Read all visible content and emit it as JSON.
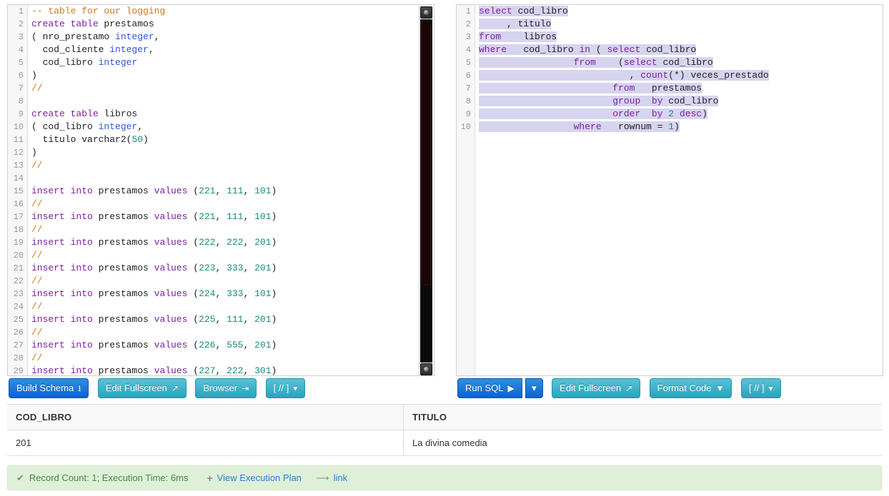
{
  "schema_editor": {
    "line_numbers": [
      1,
      2,
      3,
      4,
      5,
      6,
      7,
      8,
      9,
      10,
      11,
      12,
      13,
      14,
      15,
      16,
      17,
      18,
      19,
      20,
      21,
      22,
      23,
      24,
      25,
      26,
      27,
      28,
      29
    ],
    "lines": [
      [
        {
          "t": "cmt",
          "v": "-- table for our logging"
        }
      ],
      [
        {
          "t": "kw",
          "v": "create table "
        },
        {
          "t": "pln",
          "v": "prestamos"
        }
      ],
      [
        {
          "t": "pln",
          "v": "( nro_prestamo "
        },
        {
          "t": "typ",
          "v": "integer"
        },
        {
          "t": "pln",
          "v": ","
        }
      ],
      [
        {
          "t": "pln",
          "v": "  cod_cliente "
        },
        {
          "t": "typ",
          "v": "integer"
        },
        {
          "t": "pln",
          "v": ","
        }
      ],
      [
        {
          "t": "pln",
          "v": "  cod_libro "
        },
        {
          "t": "typ",
          "v": "integer"
        }
      ],
      [
        {
          "t": "pln",
          "v": ")"
        }
      ],
      [
        {
          "t": "cmt",
          "v": "//"
        }
      ],
      [],
      [
        {
          "t": "kw",
          "v": "create table "
        },
        {
          "t": "pln",
          "v": "libros"
        }
      ],
      [
        {
          "t": "pln",
          "v": "( cod_libro "
        },
        {
          "t": "typ",
          "v": "integer"
        },
        {
          "t": "pln",
          "v": ","
        }
      ],
      [
        {
          "t": "pln",
          "v": "  titulo varchar2("
        },
        {
          "t": "num",
          "v": "50"
        },
        {
          "t": "pln",
          "v": ")"
        }
      ],
      [
        {
          "t": "pln",
          "v": ")"
        }
      ],
      [
        {
          "t": "cmt",
          "v": "//"
        }
      ],
      [],
      [
        {
          "t": "kw",
          "v": "insert into "
        },
        {
          "t": "pln",
          "v": "prestamos "
        },
        {
          "t": "kw",
          "v": "values "
        },
        {
          "t": "pln",
          "v": "("
        },
        {
          "t": "num",
          "v": "221"
        },
        {
          "t": "pln",
          "v": ", "
        },
        {
          "t": "num",
          "v": "111"
        },
        {
          "t": "pln",
          "v": ", "
        },
        {
          "t": "num",
          "v": "101"
        },
        {
          "t": "pln",
          "v": ")"
        }
      ],
      [
        {
          "t": "cmt",
          "v": "//"
        }
      ],
      [
        {
          "t": "kw",
          "v": "insert into "
        },
        {
          "t": "pln",
          "v": "prestamos "
        },
        {
          "t": "kw",
          "v": "values "
        },
        {
          "t": "pln",
          "v": "("
        },
        {
          "t": "num",
          "v": "221"
        },
        {
          "t": "pln",
          "v": ", "
        },
        {
          "t": "num",
          "v": "111"
        },
        {
          "t": "pln",
          "v": ", "
        },
        {
          "t": "num",
          "v": "101"
        },
        {
          "t": "pln",
          "v": ")"
        }
      ],
      [
        {
          "t": "cmt",
          "v": "//"
        }
      ],
      [
        {
          "t": "kw",
          "v": "insert into "
        },
        {
          "t": "pln",
          "v": "prestamos "
        },
        {
          "t": "kw",
          "v": "values "
        },
        {
          "t": "pln",
          "v": "("
        },
        {
          "t": "num",
          "v": "222"
        },
        {
          "t": "pln",
          "v": ", "
        },
        {
          "t": "num",
          "v": "222"
        },
        {
          "t": "pln",
          "v": ", "
        },
        {
          "t": "num",
          "v": "201"
        },
        {
          "t": "pln",
          "v": ")"
        }
      ],
      [
        {
          "t": "cmt",
          "v": "//"
        }
      ],
      [
        {
          "t": "kw",
          "v": "insert into "
        },
        {
          "t": "pln",
          "v": "prestamos "
        },
        {
          "t": "kw",
          "v": "values "
        },
        {
          "t": "pln",
          "v": "("
        },
        {
          "t": "num",
          "v": "223"
        },
        {
          "t": "pln",
          "v": ", "
        },
        {
          "t": "num",
          "v": "333"
        },
        {
          "t": "pln",
          "v": ", "
        },
        {
          "t": "num",
          "v": "201"
        },
        {
          "t": "pln",
          "v": ")"
        }
      ],
      [
        {
          "t": "cmt",
          "v": "//"
        }
      ],
      [
        {
          "t": "kw",
          "v": "insert into "
        },
        {
          "t": "pln",
          "v": "prestamos "
        },
        {
          "t": "kw",
          "v": "values "
        },
        {
          "t": "pln",
          "v": "("
        },
        {
          "t": "num",
          "v": "224"
        },
        {
          "t": "pln",
          "v": ", "
        },
        {
          "t": "num",
          "v": "333"
        },
        {
          "t": "pln",
          "v": ", "
        },
        {
          "t": "num",
          "v": "101"
        },
        {
          "t": "pln",
          "v": ")"
        }
      ],
      [
        {
          "t": "cmt",
          "v": "//"
        }
      ],
      [
        {
          "t": "kw",
          "v": "insert into "
        },
        {
          "t": "pln",
          "v": "prestamos "
        },
        {
          "t": "kw",
          "v": "values "
        },
        {
          "t": "pln",
          "v": "("
        },
        {
          "t": "num",
          "v": "225"
        },
        {
          "t": "pln",
          "v": ", "
        },
        {
          "t": "num",
          "v": "111"
        },
        {
          "t": "pln",
          "v": ", "
        },
        {
          "t": "num",
          "v": "201"
        },
        {
          "t": "pln",
          "v": ")"
        }
      ],
      [
        {
          "t": "cmt",
          "v": "//"
        }
      ],
      [
        {
          "t": "kw",
          "v": "insert into "
        },
        {
          "t": "pln",
          "v": "prestamos "
        },
        {
          "t": "kw",
          "v": "values "
        },
        {
          "t": "pln",
          "v": "("
        },
        {
          "t": "num",
          "v": "226"
        },
        {
          "t": "pln",
          "v": ", "
        },
        {
          "t": "num",
          "v": "555"
        },
        {
          "t": "pln",
          "v": ", "
        },
        {
          "t": "num",
          "v": "201"
        },
        {
          "t": "pln",
          "v": ")"
        }
      ],
      [
        {
          "t": "cmt",
          "v": "//"
        }
      ],
      [
        {
          "t": "kw",
          "v": "insert into "
        },
        {
          "t": "pln",
          "v": "prestamos "
        },
        {
          "t": "kw",
          "v": "values "
        },
        {
          "t": "pln",
          "v": "("
        },
        {
          "t": "num",
          "v": "227"
        },
        {
          "t": "pln",
          "v": ", "
        },
        {
          "t": "num",
          "v": "222"
        },
        {
          "t": "pln",
          "v": ", "
        },
        {
          "t": "num",
          "v": "301"
        },
        {
          "t": "pln",
          "v": ")"
        }
      ]
    ]
  },
  "query_editor": {
    "line_numbers": [
      1,
      2,
      3,
      4,
      5,
      6,
      7,
      8,
      9,
      10
    ],
    "lines": [
      {
        "selected": true,
        "tokens": [
          {
            "t": "kw",
            "v": "select"
          },
          {
            "t": "pln",
            "v": " cod_libro"
          }
        ]
      },
      {
        "selected": true,
        "tokens": [
          {
            "t": "pln",
            "v": "     , titulo"
          }
        ]
      },
      {
        "selected": true,
        "tokens": [
          {
            "t": "kw",
            "v": "from"
          },
          {
            "t": "pln",
            "v": "    libros"
          }
        ]
      },
      {
        "selected": true,
        "tokens": [
          {
            "t": "kw",
            "v": "where"
          },
          {
            "t": "pln",
            "v": "   cod_libro "
          },
          {
            "t": "kw",
            "v": "in"
          },
          {
            "t": "pln",
            "v": " ( "
          },
          {
            "t": "kw",
            "v": "select"
          },
          {
            "t": "pln",
            "v": " cod_libro"
          }
        ]
      },
      {
        "selected": true,
        "tokens": [
          {
            "t": "pln",
            "v": "                 "
          },
          {
            "t": "kw",
            "v": "from"
          },
          {
            "t": "pln",
            "v": "    ("
          },
          {
            "t": "kw",
            "v": "select"
          },
          {
            "t": "pln",
            "v": " cod_libro"
          }
        ]
      },
      {
        "selected": true,
        "tokens": [
          {
            "t": "pln",
            "v": "                           , "
          },
          {
            "t": "kw",
            "v": "count"
          },
          {
            "t": "pln",
            "v": "(*) veces_prestado"
          }
        ]
      },
      {
        "selected": true,
        "tokens": [
          {
            "t": "pln",
            "v": "                        "
          },
          {
            "t": "kw",
            "v": "from"
          },
          {
            "t": "pln",
            "v": "   prestamos"
          }
        ]
      },
      {
        "selected": true,
        "tokens": [
          {
            "t": "pln",
            "v": "                        "
          },
          {
            "t": "kw",
            "v": "group"
          },
          {
            "t": "pln",
            "v": "  "
          },
          {
            "t": "kw",
            "v": "by"
          },
          {
            "t": "pln",
            "v": " cod_libro"
          }
        ]
      },
      {
        "selected": true,
        "tokens": [
          {
            "t": "pln",
            "v": "                        "
          },
          {
            "t": "kw",
            "v": "order"
          },
          {
            "t": "pln",
            "v": "  "
          },
          {
            "t": "kw",
            "v": "by"
          },
          {
            "t": "pln",
            "v": " "
          },
          {
            "t": "num",
            "v": "2"
          },
          {
            "t": "pln",
            "v": " "
          },
          {
            "t": "kw",
            "v": "desc"
          },
          {
            "t": "pln",
            "v": ")"
          }
        ]
      },
      {
        "selected": true,
        "tokens": [
          {
            "t": "pln",
            "v": "                 "
          },
          {
            "t": "kw",
            "v": "where"
          },
          {
            "t": "pln",
            "v": "   rownum = "
          },
          {
            "t": "num",
            "v": "1"
          },
          {
            "t": "pln",
            "v": ")"
          }
        ]
      }
    ]
  },
  "schema_toolbar": {
    "build_schema": "Build Schema",
    "build_schema_icon": "download-icon",
    "edit_fullscreen": "Edit Fullscreen",
    "edit_fullscreen_icon": "expand-icon",
    "browser": "Browser",
    "browser_icon": "indent-icon",
    "terminator": "[ // ]",
    "terminator_caret": "▾"
  },
  "query_toolbar": {
    "run_sql": "Run SQL",
    "run_sql_icon": "play-icon",
    "run_caret": "▾",
    "edit_fullscreen": "Edit Fullscreen",
    "edit_fullscreen_icon": "expand-icon",
    "format_code": "Format Code",
    "format_code_icon": "filter-icon",
    "terminator": "[ // ]",
    "terminator_caret": "▾"
  },
  "results": {
    "columns": [
      "COD_LIBRO",
      "TITULO"
    ],
    "rows": [
      [
        "201",
        "La divina comedia"
      ]
    ]
  },
  "status": {
    "check_icon": "check-icon",
    "message": "Record Count: 1; Execution Time: 6ms",
    "plus_icon": "plus-icon",
    "execution_plan_label": "View Execution Plan",
    "arrow_icon": "share-arrow-icon",
    "link_label": "link"
  },
  "colors": {
    "primary_button": "#0a62cf",
    "info_button": "#2aa3bd",
    "selection": "#d7d4f0",
    "status_bg": "#dff0d8",
    "status_text": "#468847",
    "link": "#2a7fd4"
  }
}
